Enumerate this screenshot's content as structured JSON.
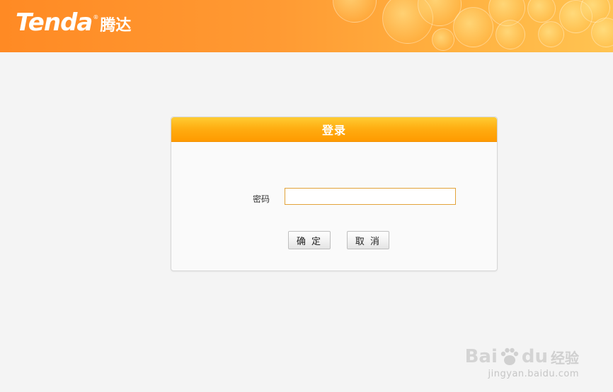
{
  "header": {
    "logo_latin": "Tenda",
    "logo_registered": "®",
    "logo_cn": "腾达",
    "colors": {
      "start": "#ff8a24",
      "end": "#ffc452"
    }
  },
  "login": {
    "title": "登录",
    "password_label": "密码",
    "password_value": "",
    "ok_button": "确 定",
    "cancel_button": "取 消",
    "accent_color": "#ffae12"
  },
  "watermark": {
    "brand_a": "Bai",
    "brand_b": "du",
    "brand_cn": "经验",
    "url": "jingyan.baidu.com"
  }
}
